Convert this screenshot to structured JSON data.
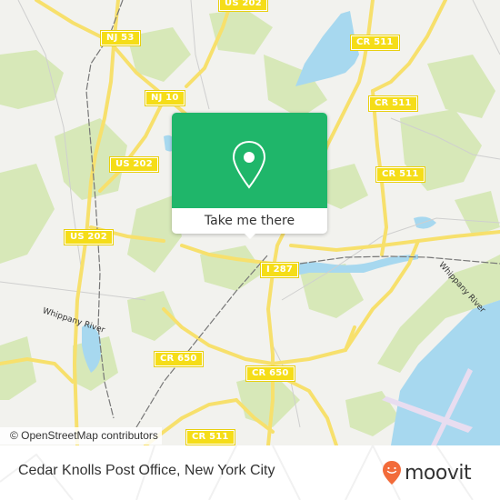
{
  "map": {
    "road_labels": [
      {
        "id": "us202-top",
        "text": "US 202"
      },
      {
        "id": "nj53",
        "text": "NJ 53"
      },
      {
        "id": "nj10",
        "text": "NJ 10"
      },
      {
        "id": "cr511-a",
        "text": "CR 511"
      },
      {
        "id": "cr511-b",
        "text": "CR 511"
      },
      {
        "id": "us202-mid",
        "text": "US 202"
      },
      {
        "id": "cr511-c",
        "text": "CR 511"
      },
      {
        "id": "us202-low",
        "text": "US 202"
      },
      {
        "id": "i287",
        "text": "I 287"
      },
      {
        "id": "cr650-a",
        "text": "CR 650"
      },
      {
        "id": "cr650-b",
        "text": "CR 650"
      },
      {
        "id": "cr511-d",
        "text": "CR 511"
      }
    ],
    "water_labels": [
      {
        "id": "whippany-river-east",
        "text": "Whippany River"
      },
      {
        "id": "whippany-river-west",
        "text": "Whippany River"
      }
    ],
    "colors": {
      "land": "#f2f2ee",
      "park": "#d7e8b8",
      "water": "#a7d8ef",
      "road": "#f7e06c",
      "shield": "#f5dd18",
      "airport": "#e8ddf0",
      "rail": "#777777"
    }
  },
  "popup": {
    "icon": "map-pin-icon",
    "button_label": "Take me there",
    "color": "#1fb66a"
  },
  "attribution": "© OpenStreetMap contributors",
  "footer": {
    "place_title": "Cedar Knolls Post Office, New York City",
    "brand": "moovit",
    "brand_color": "#f26b3a"
  }
}
